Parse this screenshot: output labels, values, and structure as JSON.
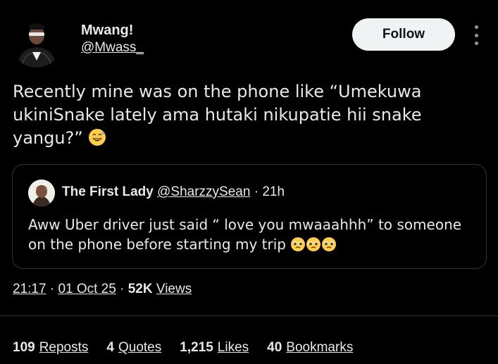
{
  "author": {
    "name": "Mwang!",
    "handle": "@Mwass_"
  },
  "follow_label": "Follow",
  "tweet": {
    "text": "Recently mine was on the phone like “Umekuwa ukiniSnake lately ama hutaki nikupatie hii snake yangu?” ",
    "emoji": "grinning-sweat-emoji"
  },
  "quote": {
    "name": "The First Lady",
    "handle": "@SharzzySean",
    "separator": "·",
    "time": "21h",
    "text": "Aww Uber driver just said “ love you mwaaahhh” to someone on the phone before starting my trip ",
    "emojis": [
      "pleading-face-emoji",
      "pleading-face-emoji",
      "pleading-face-emoji"
    ]
  },
  "meta": {
    "time": "21:17",
    "sep1": "·",
    "date": "01 Oct 25",
    "sep2": "·",
    "views_count": "52K",
    "views_label": "Views"
  },
  "stats": [
    {
      "count": "109",
      "label": "Reposts"
    },
    {
      "count": "4",
      "label": "Quotes"
    },
    {
      "count": "1,215",
      "label": "Likes"
    },
    {
      "count": "40",
      "label": "Bookmarks"
    }
  ],
  "colors": {
    "background": "#000000",
    "text": "#e7e9ea",
    "secondary": "#8b98a5",
    "border": "#2f3336",
    "follow_bg": "#eff3f4"
  }
}
